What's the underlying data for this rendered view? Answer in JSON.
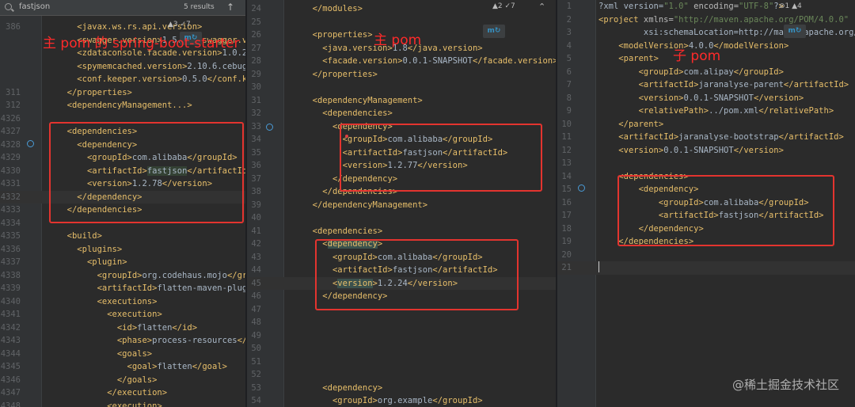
{
  "search": {
    "query": "fastjson",
    "results": "5 results"
  },
  "pane1": {
    "inspection": "▲3 ✓7",
    "annotation": "主 pom 的 spring-boot-starter",
    "lines": [
      {
        "n": "386",
        "t": "    <javax.ws.rs.api.version>"
      },
      {
        "n": "",
        "t": "    <swagger.version>1.5.14</swagger.version>"
      },
      {
        "n": "",
        "t": "    <zdataconsole.facade.version>1.0.2.1"
      },
      {
        "n": "",
        "t": "    <spymemcached.version>2.10.6.cebugfix"
      },
      {
        "n": "",
        "t": "    <conf.keeper.version>0.5.0</conf.keeper"
      },
      {
        "n": "311",
        "t": "  </properties>"
      },
      {
        "n": "312",
        "t": "  <dependencyManagement...>"
      },
      {
        "n": "4326",
        "t": ""
      },
      {
        "n": "4327",
        "t": "  <dependencies>"
      },
      {
        "n": "4328",
        "t": "    <dependency>"
      },
      {
        "n": "4329",
        "t": "      <groupId>com.alibaba</groupId>"
      },
      {
        "n": "4330",
        "t": "      <artifactId>fastjson</artifactId>"
      },
      {
        "n": "4331",
        "t": "      <version>1.2.78</version>"
      },
      {
        "n": "4332",
        "t": "    </dependency>"
      },
      {
        "n": "4333",
        "t": "  </dependencies>"
      },
      {
        "n": "4334",
        "t": ""
      },
      {
        "n": "4335",
        "t": "  <build>"
      },
      {
        "n": "4336",
        "t": "    <plugins>"
      },
      {
        "n": "4337",
        "t": "      <plugin>"
      },
      {
        "n": "4338",
        "t": "        <groupId>org.codehaus.mojo</groupId>"
      },
      {
        "n": "4339",
        "t": "        <artifactId>flatten-maven-plugin"
      },
      {
        "n": "4340",
        "t": "        <executions>"
      },
      {
        "n": "4341",
        "t": "          <execution>"
      },
      {
        "n": "4342",
        "t": "            <id>flatten</id>"
      },
      {
        "n": "4343",
        "t": "            <phase>process-resources</phase>"
      },
      {
        "n": "4344",
        "t": "            <goals>"
      },
      {
        "n": "4345",
        "t": "              <goal>flatten</goal>"
      },
      {
        "n": "4346",
        "t": "            </goals>"
      },
      {
        "n": "4347",
        "t": "          </execution>"
      },
      {
        "n": "4348",
        "t": "          <execution>"
      }
    ]
  },
  "pane2": {
    "inspection": "▲2 ✓7",
    "annotation": "主 pom",
    "lines": [
      {
        "n": "24",
        "t": "  </modules>"
      },
      {
        "n": "25",
        "t": ""
      },
      {
        "n": "26",
        "t": "  <properties>"
      },
      {
        "n": "27",
        "t": "    <java.version>1.8</java.version>"
      },
      {
        "n": "28",
        "t": "    <facade.version>0.0.1-SNAPSHOT</facade.version>"
      },
      {
        "n": "29",
        "t": "  </properties>"
      },
      {
        "n": "30",
        "t": ""
      },
      {
        "n": "31",
        "t": "  <dependencyManagement>"
      },
      {
        "n": "32",
        "t": "    <dependencies>"
      },
      {
        "n": "33",
        "t": "      <dependency>"
      },
      {
        "n": "34",
        "t": "        <groupId>com.alibaba</groupId>"
      },
      {
        "n": "35",
        "t": "        <artifactId>fastjson</artifactId>"
      },
      {
        "n": "36",
        "t": "        <version>1.2.77</version>"
      },
      {
        "n": "37",
        "t": "      </dependency>"
      },
      {
        "n": "38",
        "t": "    </dependencies>"
      },
      {
        "n": "39",
        "t": "  </dependencyManagement>"
      },
      {
        "n": "40",
        "t": ""
      },
      {
        "n": "41",
        "t": "  <dependencies>"
      },
      {
        "n": "42",
        "t": "    <dependency>"
      },
      {
        "n": "43",
        "t": "      <groupId>com.alibaba</groupId>"
      },
      {
        "n": "44",
        "t": "      <artifactId>fastjson</artifactId>"
      },
      {
        "n": "45",
        "t": "      <version>1.2.24</version>"
      },
      {
        "n": "46",
        "t": "    </dependency>"
      },
      {
        "n": "47",
        "t": ""
      },
      {
        "n": "48",
        "t": ""
      },
      {
        "n": "49",
        "t": ""
      },
      {
        "n": "50",
        "t": ""
      },
      {
        "n": "51",
        "t": ""
      },
      {
        "n": "52",
        "t": ""
      },
      {
        "n": "53",
        "t": "    <dependency>"
      },
      {
        "n": "54",
        "t": "      <groupId>org.example</groupId>"
      }
    ]
  },
  "pane3": {
    "inspection": "⊘1 ▲4",
    "annotation": "子 pom",
    "lines": [
      {
        "n": "1",
        "t": "<?xml version=\"1.0\" encoding=\"UTF-8\"?>"
      },
      {
        "n": "2",
        "t": "<project xmlns=\"http://maven.apache.org/POM/4.0.0\""
      },
      {
        "n": "3",
        "t": "         xsi:schemaLocation=\"http://maven.apache.org/POM"
      },
      {
        "n": "4",
        "t": "    <modelVersion>4.0.0</modelVersion>"
      },
      {
        "n": "5",
        "t": "    <parent>"
      },
      {
        "n": "6",
        "t": "        <groupId>com.alipay</groupId>"
      },
      {
        "n": "7",
        "t": "        <artifactId>jaranalyse-parent</artifactId>"
      },
      {
        "n": "8",
        "t": "        <version>0.0.1-SNAPSHOT</version>"
      },
      {
        "n": "9",
        "t": "        <relativePath>../pom.xml</relativePath>"
      },
      {
        "n": "10",
        "t": "    </parent>"
      },
      {
        "n": "11",
        "t": "    <artifactId>jaranalyse-bootstrap</artifactId>"
      },
      {
        "n": "12",
        "t": "    <version>0.0.1-SNAPSHOT</version>"
      },
      {
        "n": "13",
        "t": ""
      },
      {
        "n": "14",
        "t": "    <dependencies>"
      },
      {
        "n": "15",
        "t": "        <dependency>"
      },
      {
        "n": "16",
        "t": "            <groupId>com.alibaba</groupId>"
      },
      {
        "n": "17",
        "t": "            <artifactId>fastjson</artifactId>"
      },
      {
        "n": "18",
        "t": "        </dependency>"
      },
      {
        "n": "19",
        "t": "    </dependencies>"
      },
      {
        "n": "20",
        "t": ""
      },
      {
        "n": "21",
        "t": ""
      }
    ]
  },
  "maven_badge": "m↻",
  "watermark": "@稀土掘金技术社区"
}
